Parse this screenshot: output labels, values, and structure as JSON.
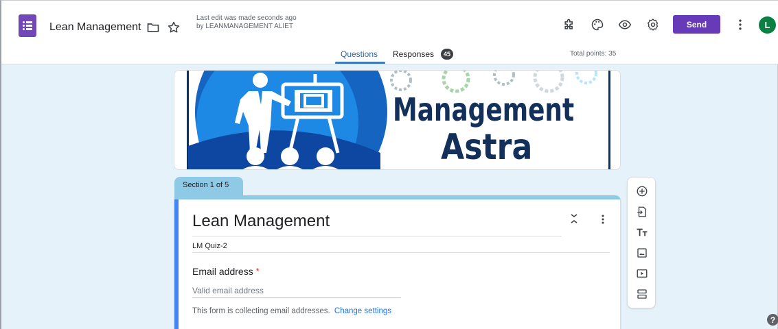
{
  "header": {
    "doc_title": "Lean Management",
    "last_edit": "Last edit was made seconds ago by LEANMANAGEMENT ALIET",
    "send_label": "Send",
    "avatar_initial": "L",
    "icons": [
      "forms-logo-icon",
      "folder-icon",
      "star-icon",
      "addon-puzzle-icon",
      "palette-icon",
      "preview-eye-icon",
      "settings-gear-icon",
      "more-vert-icon"
    ]
  },
  "tabs": {
    "questions": "Questions",
    "responses": "Responses",
    "responses_count": "45",
    "total_points": "Total points: 35"
  },
  "banner": {
    "line1": "Management",
    "line2": "Astra"
  },
  "section": {
    "label": "Section 1 of 5"
  },
  "form": {
    "title": "Lean Management",
    "description": "LM Quiz-2",
    "email_label": "Email address",
    "required_mark": "*",
    "email_placeholder": "Valid email address",
    "collect_note": "This form is collecting email addresses.",
    "change_settings": "Change settings"
  },
  "toolbar": {
    "tools": [
      "add-question-icon",
      "import-questions-icon",
      "add-title-icon",
      "add-image-icon",
      "add-video-icon",
      "add-section-icon"
    ]
  },
  "colors": {
    "brand": "#673ab7",
    "section_bar": "#8ecae6",
    "page_bg": "#e6f2fa",
    "accent_blue": "#1a73e8",
    "avatar": "#0b8043"
  }
}
